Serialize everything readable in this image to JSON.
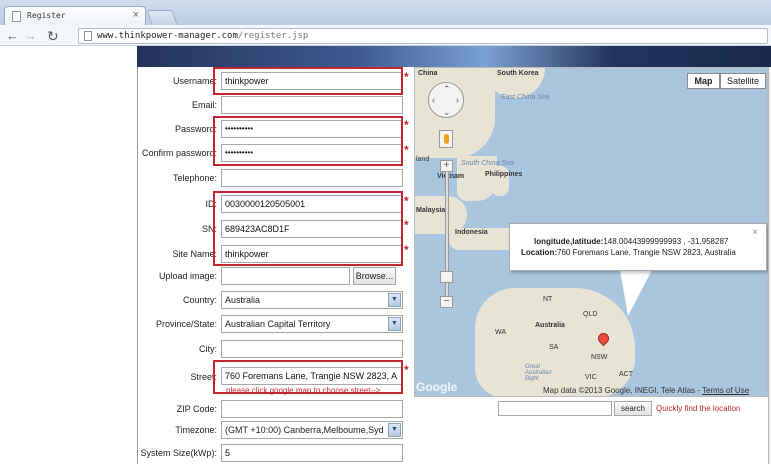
{
  "browser": {
    "tab_title": "Register",
    "tab_close": "×",
    "url_host": "www.thinkpower-manager.com",
    "url_path": "/register.jsp",
    "back_icon": "back-arrow-icon",
    "forward_icon": "forward-arrow-icon",
    "reload_icon": "reload-icon"
  },
  "form": {
    "username": {
      "label": "Username:",
      "value": "thinkpower"
    },
    "email": {
      "label": "Email:",
      "value": ""
    },
    "password": {
      "label": "Password:",
      "value": "••••••••••"
    },
    "confirm": {
      "label": "Confirm password:",
      "value": "••••••••••"
    },
    "telephone": {
      "label": "Telephone:",
      "value": ""
    },
    "id": {
      "label": "ID:",
      "value": "0030000120505001"
    },
    "sn": {
      "label": "SN:",
      "value": "689423AC8D1F"
    },
    "site_name": {
      "label": "Site Name:",
      "value": "thinkpower"
    },
    "upload": {
      "label": "Upload image:",
      "button": "Browse..."
    },
    "country": {
      "label": "Country:",
      "value": "Australia"
    },
    "province": {
      "label": "Province/State:",
      "value": "Australian Capital Territory"
    },
    "city": {
      "label": "City:",
      "value": ""
    },
    "street": {
      "label": "Street:",
      "value": "760 Foremans Lane, Trangie NSW 2823, A",
      "hint": "please click google map to choose street-->"
    },
    "zip": {
      "label": "ZIP Code:",
      "value": ""
    },
    "timezone": {
      "label": "Timezone:",
      "value": "(GMT +10:00) Canberra,Melboume,Syd"
    },
    "system_size": {
      "label": "System Size(kWp):",
      "value": "5"
    },
    "required_mark": "*"
  },
  "map": {
    "btn_map": "Map",
    "btn_satellite": "Satellite",
    "labels": {
      "china": "China",
      "south_korea": "South Korea",
      "east_china_sea": "East China Sea",
      "south_china_sea": "South China Sea",
      "vietnam": "Vietnam",
      "philippines": "Philippines",
      "malaysia": "Malaysia",
      "indonesia": "Indonesia",
      "wa": "WA",
      "nt": "NT",
      "qld": "QLD",
      "australia": "Australia",
      "sa": "SA",
      "nsw": "NSW",
      "vic": "VIC",
      "act": "ACT",
      "great_australian_bight": "Great Australian Bight",
      "land_edge": "land"
    },
    "info": {
      "line1_label": "longitude,latitude:",
      "line1_value": "148.00443999999993 , -31.958287",
      "line2_label": "Location:",
      "line2_value": "760 Foremans Lane, Trangie NSW 2823, Australia",
      "close": "×"
    },
    "google": "Google",
    "copyright": "Map data ©2013 Google, INEGI, Tele Atlas - ",
    "terms": "Terms of Use",
    "search_button": "search",
    "search_hint": "Quickly find the location",
    "zoom_in": "+",
    "zoom_out": "−"
  },
  "colors": {
    "required": "#c1272d",
    "sea": "#aac6df",
    "land": "#e7e3d5"
  }
}
